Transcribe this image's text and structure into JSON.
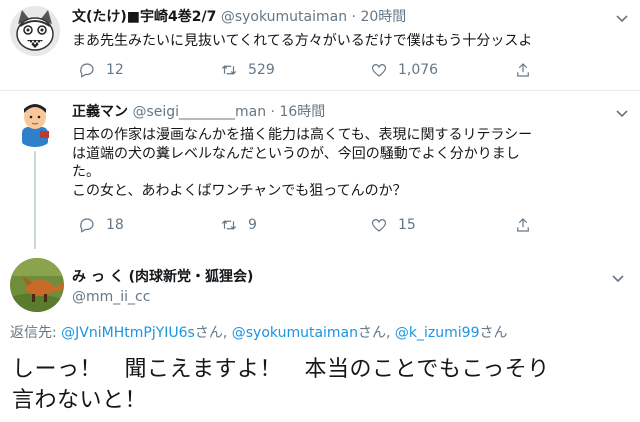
{
  "tweets": [
    {
      "name": "文(たけ)■宇崎4巻2/7",
      "handle": "@syokumutaiman",
      "dot": "·",
      "time": "20時間",
      "text": "まあ先生みたいに見抜いてくれてる方々がいるだけで僕はもう十分ッスよ",
      "replies": "12",
      "retweets": "529",
      "likes": "1,076"
    },
    {
      "name": "正義マン",
      "handle": "@seigi________man",
      "dot": "·",
      "time": "16時間",
      "text_lines": [
        "日本の作家は漫画なんかを描く能力は高くても、表現に関するリテラシー",
        "は道端の犬の糞レベルなんだというのが、今回の騒動でよく分かりまし",
        "た。",
        "この女と、あわよくばワンチャンでも狙ってんのか？"
      ],
      "replies": "18",
      "retweets": "9",
      "likes": "15"
    }
  ],
  "main_tweet": {
    "name": "み っ く (肉球新党・狐狸会)",
    "handle": "@mm_ii_cc",
    "reply_prefix": "返信先: ",
    "reply_to": [
      {
        "user": "@JVniMHtmPjYIU6s",
        "sep": "さん, "
      },
      {
        "user": "@syokumutaiman",
        "sep": "さん, "
      },
      {
        "user": "@k_izumi99",
        "sep": "さん"
      }
    ],
    "text_lines": [
      "しーっ！　聞こえますよ！　本当のことでもこっそり",
      "言わないと！"
    ]
  },
  "colors": {
    "accent": "#1b95e0",
    "muted": "#657786",
    "divider": "#e6ecf0"
  },
  "icons": [
    "reply-icon",
    "retweet-icon",
    "like-icon",
    "share-icon",
    "chevron-down-icon"
  ]
}
